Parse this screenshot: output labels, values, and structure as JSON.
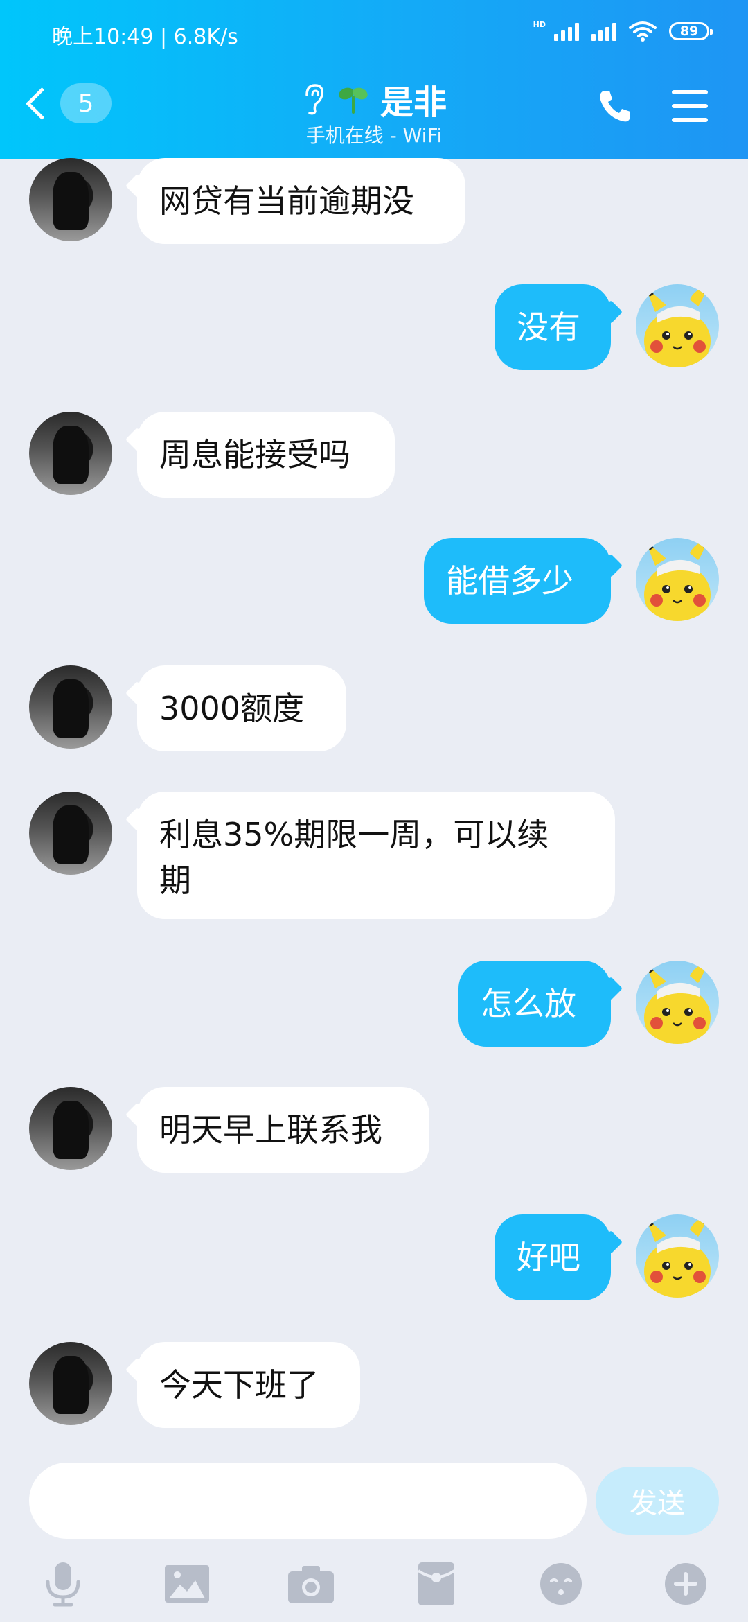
{
  "status_bar": {
    "time_speed": "晚上10:49 | 6.8K/s",
    "hd": "HD",
    "battery": "89"
  },
  "header": {
    "unread_count": "5",
    "title": "是非",
    "subtitle": "手机在线 - WiFi",
    "icons": [
      "back-chevron-icon",
      "ear-icon",
      "sprout-icon",
      "phone-icon",
      "menu-icon"
    ],
    "accent": "#1ebcfa"
  },
  "messages": [
    {
      "side": "in",
      "text": "网贷有当前逾期没"
    },
    {
      "side": "out",
      "text": "没有"
    },
    {
      "side": "in",
      "text": "周息能接受吗"
    },
    {
      "side": "out",
      "text": "能借多少"
    },
    {
      "side": "in",
      "text": "3000额度"
    },
    {
      "side": "in",
      "text": "利息35%期限一周，可以续",
      "text2": "期"
    },
    {
      "side": "out",
      "text": "怎么放"
    },
    {
      "side": "in",
      "text": "明天早上联系我"
    },
    {
      "side": "out",
      "text": "好吧"
    },
    {
      "side": "in",
      "text": "今天下班了"
    }
  ],
  "input": {
    "value": "",
    "send_label": "发送"
  },
  "toolbar": [
    "microphone-icon",
    "image-icon",
    "camera-icon",
    "red-packet-icon",
    "emoji-icon",
    "plus-icon"
  ]
}
